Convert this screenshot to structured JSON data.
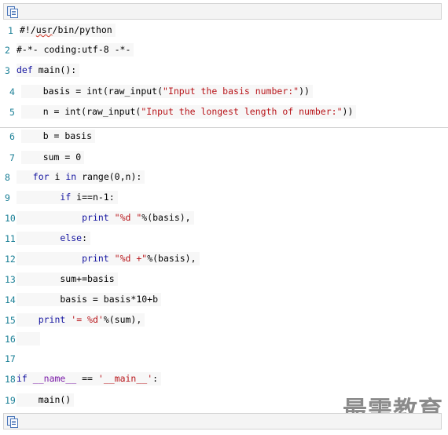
{
  "toolbar": {
    "top_icon": "view-source-icon",
    "bottom_icon": "view-source-icon"
  },
  "code_lines": [
    {
      "num": "1",
      "text": "#!/usr/bin/python"
    },
    {
      "num": "2",
      "text": "#-*- coding:utf-8 -*-"
    },
    {
      "num": "3",
      "text": "def main():"
    },
    {
      "num": "4",
      "text": "basis = int(raw_input(\"Input the basis number:\"))"
    },
    {
      "num": "5",
      "text": "n = int(raw_input(\"Input the longest length of number:\"))"
    },
    {
      "num": "6",
      "text": "b = basis"
    },
    {
      "num": "7",
      "text": "sum = 0"
    },
    {
      "num": "8",
      "text": "for i in range(0,n):"
    },
    {
      "num": "9",
      "text": "if i==n-1:"
    },
    {
      "num": "10",
      "text": "print \"%d \"%(basis),"
    },
    {
      "num": "11",
      "text": "else:"
    },
    {
      "num": "12",
      "text": "print \"%d +\"%(basis),"
    },
    {
      "num": "13",
      "text": "sum+=basis"
    },
    {
      "num": "14",
      "text": "basis = basis*10+b"
    },
    {
      "num": "15",
      "text": "print '= %d'%(sum),"
    },
    {
      "num": "16",
      "text": ""
    },
    {
      "num": "17",
      "text": ""
    },
    {
      "num": "18",
      "text": "if __name__ == '__main__':"
    },
    {
      "num": "19",
      "text": "main()"
    }
  ],
  "watermark": "最需教育"
}
